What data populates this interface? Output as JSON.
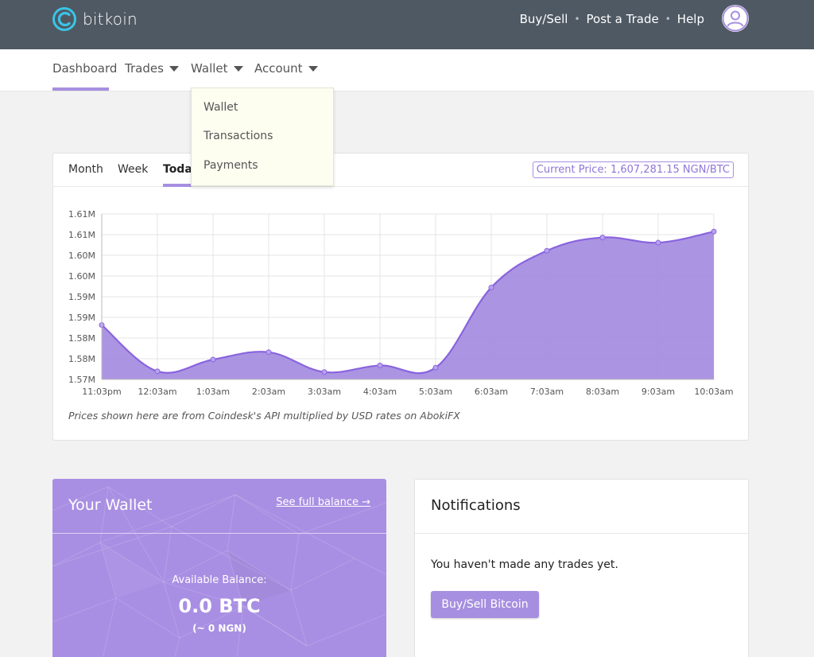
{
  "brand": {
    "name": "bitkoin",
    "logo_icon": "bitkoin-logo-icon"
  },
  "topnav": {
    "items": [
      "Buy/Sell",
      "Post a Trade",
      "Help"
    ],
    "separator": "•"
  },
  "subnav": {
    "items": [
      {
        "label": "Dashboard",
        "active": true,
        "has_caret": false
      },
      {
        "label": "Trades",
        "has_caret": true
      },
      {
        "label": "Wallet",
        "has_caret": true
      },
      {
        "label": "Account",
        "has_caret": true
      }
    ]
  },
  "wallet_dropdown": {
    "items": [
      "Wallet",
      "Transactions",
      "Payments"
    ]
  },
  "chart_card": {
    "tabs": [
      "Month",
      "Week",
      "Today"
    ],
    "active_tab": "Today",
    "current_price": "Current Price: 1,607,281.15 NGN/BTC",
    "note": "Prices shown here are from Coindesk's API multiplied by USD rates on AbokiFX"
  },
  "chart_data": {
    "type": "area",
    "x": [
      "11:03pm",
      "12:03am",
      "1:03am",
      "2:03am",
      "3:03am",
      "4:03am",
      "5:03am",
      "6:03am",
      "7:03am",
      "8:03am",
      "9:03am",
      "10:03am"
    ],
    "values": [
      1584800,
      1572200,
      1575400,
      1577400,
      1572000,
      1573800,
      1573200,
      1595000,
      1605000,
      1608600,
      1607200,
      1610200
    ],
    "yticks": [
      "1.61M",
      "1.61M",
      "1.60M",
      "1.60M",
      "1.59M",
      "1.59M",
      "1.58M",
      "1.58M",
      "1.57M"
    ],
    "ylim": [
      1570000,
      1615000
    ],
    "grid": true,
    "colors": {
      "fill": "#a68fe0",
      "line": "#8a63de"
    }
  },
  "wallet_card": {
    "title": "Your Wallet",
    "link": "See full balance →",
    "label": "Available Balance:",
    "btc": "0.0 BTC",
    "ngn": "(~ 0 NGN)"
  },
  "notifications": {
    "title": "Notifications",
    "empty_text": "You haven't made any trades yet.",
    "button": "Buy/Sell Bitcoin"
  },
  "colors": {
    "topbar": "#4f5963",
    "accent": "#a68fe0",
    "page_bg": "#f2f2f2"
  }
}
